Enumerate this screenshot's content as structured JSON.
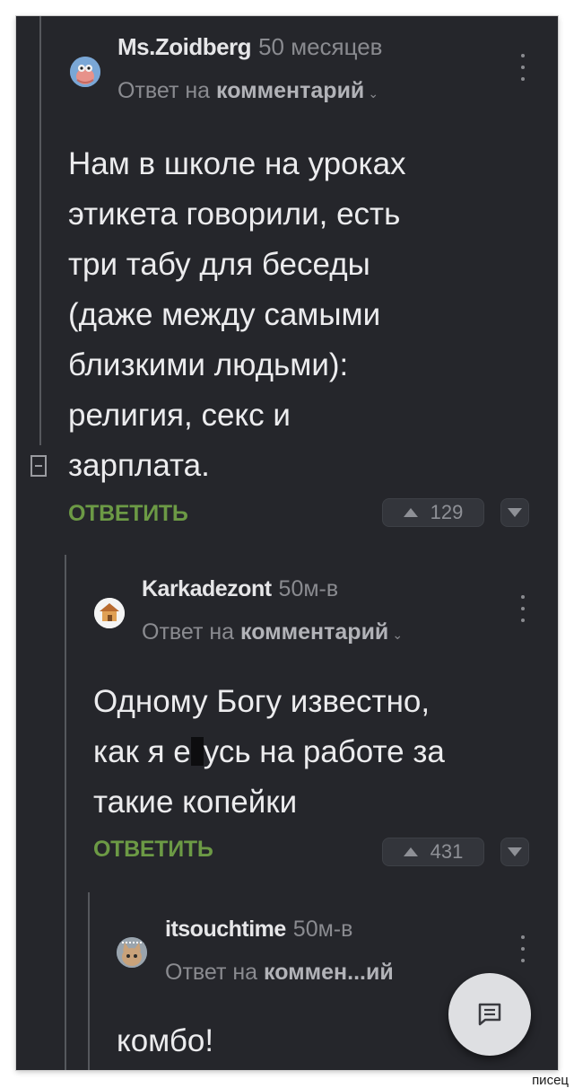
{
  "comments": [
    {
      "author": "Ms.Zoidberg",
      "time": "50 месяцев",
      "reply_prefix": "Ответ на",
      "reply_target": "комментарий",
      "text": "Нам в школе на уроках\nэтикета говорили, есть\nтри табу для беседы\n(даже между самыми\nблизкими людьми):\nрелигия, секс и\nзарплата.",
      "reply_label": "ОТВЕТИТЬ",
      "votes": "129"
    },
    {
      "author": "Karkadezont",
      "time": "50м-в",
      "reply_prefix": "Ответ на",
      "reply_target": "комментарий",
      "text_part1": "Одному Богу известно,",
      "text_part2a": "как я е",
      "text_part2b": "усь на работе за",
      "text_part3": "такие копейки",
      "reply_label": "ОТВЕТИТЬ",
      "votes": "431"
    },
    {
      "author": "itsouchtime",
      "time": "50м-в",
      "reply_prefix": "Ответ на",
      "reply_target": "коммен...ий",
      "text": "комбо!"
    }
  ],
  "icons": {
    "kebab": "more-vertical-icon",
    "upvote": "triangle-up-icon",
    "downvote": "triangle-down-icon",
    "collapse": "minus-square-icon",
    "fab": "comment-icon"
  },
  "colors": {
    "background": "#25262b",
    "reply_green": "#6c9a45",
    "text": "#ececee",
    "muted": "#8a8b90"
  },
  "watermark": "писец"
}
